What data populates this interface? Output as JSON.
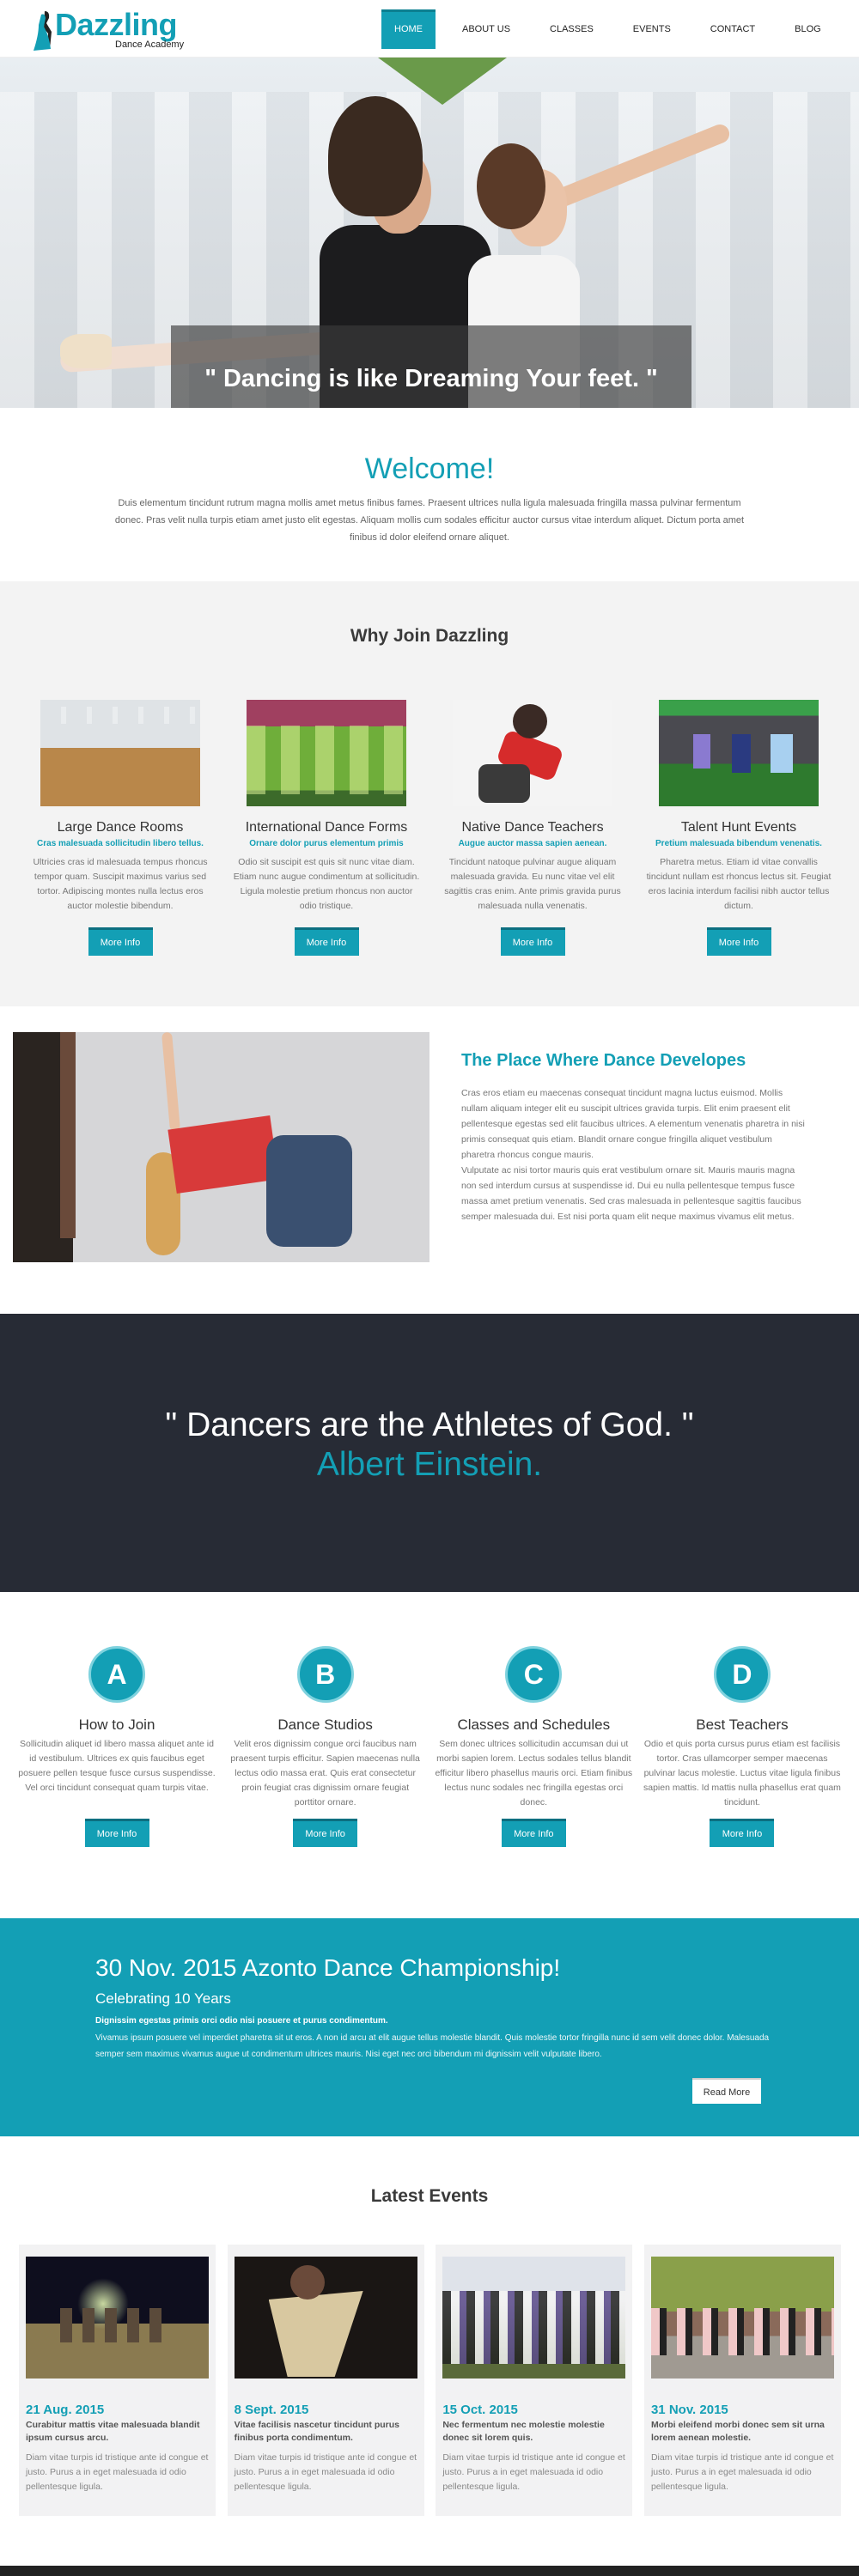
{
  "header": {
    "brand": "Dazzling",
    "tagline": "Dance Academy",
    "nav": [
      {
        "label": "HOME",
        "active": true
      },
      {
        "label": "ABOUT US",
        "active": false
      },
      {
        "label": "CLASSES",
        "active": false
      },
      {
        "label": "EVENTS",
        "active": false
      },
      {
        "label": "CONTACT",
        "active": false
      },
      {
        "label": "BLOG",
        "active": false
      }
    ]
  },
  "hero": {
    "quote": "\" Dancing is like Dreaming Your feet. \""
  },
  "welcome": {
    "title": "Welcome!",
    "text": "Duis elementum tincidunt rutrum magna mollis amet metus finibus fames. Praesent ultrices nulla ligula malesuada fringilla massa pulvinar fermentum donec. Pras velit nulla turpis etiam amet justo elit egestas. Aliquam mollis cum sodales efficitur auctor cursus vitae interdum aliquet. Dictum porta amet finibus id dolor eleifend ornare aliquet."
  },
  "why": {
    "title": "Why Join Dazzling",
    "cards": [
      {
        "title": "Large Dance Rooms",
        "tag": "Cras malesuada sollicitudin libero tellus.",
        "text": "Ultricies cras id malesuada tempus rhoncus tempor quam. Suscipit maximus varius sed tortor. Adipiscing montes nulla lectus eros auctor molestie bibendum.",
        "button": "More Info"
      },
      {
        "title": "International Dance Forms",
        "tag": "Ornare dolor purus elementum primis",
        "text": "Odio sit suscipit est quis sit nunc vitae diam. Etiam nunc augue condimentum at sollicitudin. Ligula molestie pretium rhoncus non auctor odio tristique.",
        "button": "More Info"
      },
      {
        "title": "Native Dance Teachers",
        "tag": "Augue auctor  massa sapien aenean.",
        "text": "Tincidunt natoque pulvinar augue aliquam malesuada gravida. Eu nunc vitae vel elit sagittis cras enim. Ante primis gravida purus malesuada nulla venenatis.",
        "button": "More Info"
      },
      {
        "title": "Talent Hunt Events",
        "tag": "Pretium malesuada bibendum venenatis.",
        "text": "Pharetra metus. Etiam id vitae convallis tincidunt nullam est rhoncus lectus sit. Feugiat eros lacinia interdum facilisi nibh auctor tellus dictum.",
        "button": "More Info"
      }
    ]
  },
  "place": {
    "title": "The Place Where Dance Developes",
    "p1": "Cras eros etiam eu maecenas consequat tincidunt magna luctus euismod. Mollis nullam aliquam integer elit eu suscipit ultrices gravida turpis. Elit enim praesent elit pellentesque egestas sed elit faucibus ultrices. A elementum venenatis pharetra in nisi primis consequat quis etiam. Blandit ornare congue fringilla aliquet vestibulum pharetra rhoncus congue mauris.",
    "p2": "Vulputate ac nisi tortor mauris quis erat vestibulum ornare sit. Mauris mauris magna non sed interdum cursus at suspendisse id. Dui eu nulla pellentesque tempus fusce massa amet pretium venenatis. Sed cras malesuada in pellentesque sagittis faucibus semper malesuada dui. Est nisi porta quam elit neque maximus vivamus elit metus."
  },
  "athletes": {
    "quote": "\" Dancers are the Athletes of God. \"",
    "author": "Albert Einstein."
  },
  "steps": [
    {
      "letter": "A",
      "title": "How to Join",
      "text": "Sollicitudin aliquet id libero massa aliquet ante id id vestibulum. Ultrices ex quis faucibus eget posuere pellen tesque fusce cursus suspendisse. Vel orci  tincidunt consequat quam turpis vitae.",
      "button": "More Info"
    },
    {
      "letter": "B",
      "title": "Dance Studios",
      "text": "Velit eros dignissim congue orci faucibus nam praesent turpis efficitur. Sapien maecenas nulla lectus odio massa erat. Quis erat consectetur proin feugiat cras dignissim  ornare feugiat porttitor ornare.",
      "button": "More Info"
    },
    {
      "letter": "C",
      "title": "Classes and Schedules",
      "text": "Sem donec ultrices sollicitudin accumsan dui ut morbi sapien lorem. Lectus sodales tellus blandit efficitur libero phasellus mauris orci. Etiam finibus lectus nunc sodales nec fringilla egestas orci donec.",
      "button": "More Info"
    },
    {
      "letter": "D",
      "title": "Best Teachers",
      "text": "Odio et quis porta cursus purus etiam est facilisis tortor. Cras ullamcorper semper maecenas pulvinar lacus molestie. Luctus vitae ligula finibus sapien mattis. Id mattis nulla phasellus erat quam tincidunt.",
      "button": "More Info"
    }
  ],
  "championship": {
    "title": "30 Nov. 2015 Azonto Dance Championship!",
    "subtitle": "Celebrating 10 Years",
    "lead": "Dignissim egestas primis orci odio nisi posuere et purus condimentum.",
    "body": "Vivamus ipsum posuere vel imperdiet pharetra sit ut eros. A non id arcu at elit augue tellus molestie blandit. Quis molestie tortor fringilla nunc id sem velit donec dolor. Malesuada semper sem maximus vivamus augue ut condimentum ultrices mauris. Nisi eget nec orci bibendum mi dignissim velit vulputate libero.",
    "button": "Read More"
  },
  "events": {
    "title": "Latest Events",
    "items": [
      {
        "date": "21 Aug. 2015",
        "title": "Curabitur mattis vitae malesuada blandit ipsum cursus arcu.",
        "desc": "Diam vitae turpis id tristique ante id congue et justo. Purus a in eget malesuada id odio pellentesque ligula."
      },
      {
        "date": "8 Sept. 2015",
        "title": "Vitae facilisis nascetur tincidunt purus finibus porta condimentum.",
        "desc": "Diam vitae turpis id tristique ante id congue et justo. Purus a in eget malesuada id odio pellentesque ligula."
      },
      {
        "date": "15 Oct. 2015",
        "title": "Nec fermentum nec molestie molestie donec sit lorem quis.",
        "desc": "Diam vitae turpis id tristique ante id congue et justo. Purus a in eget malesuada id odio pellentesque ligula."
      },
      {
        "date": "31 Nov. 2015",
        "title": "Morbi eleifend morbi donec sem sit urna lorem aenean molestie.",
        "desc": "Diam vitae turpis id tristique ante id congue et justo. Purus a in eget malesuada id odio pellentesque ligula."
      }
    ]
  },
  "colors": {
    "accent": "#139fb5",
    "dark_band": "#272b35",
    "light_band": "#f3f3f3"
  }
}
